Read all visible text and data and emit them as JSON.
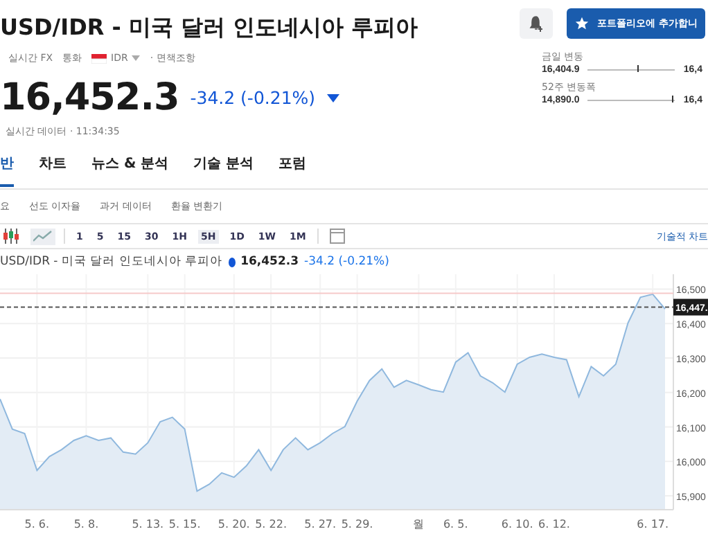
{
  "header": {
    "title": "USD/IDR - 미국 달러 인도네시아 루피아",
    "meta": [
      {
        "kind": "text",
        "text": "실시간 FX"
      },
      {
        "kind": "text",
        "text": "통화"
      },
      {
        "kind": "flag",
        "text": "IDR"
      },
      {
        "kind": "link",
        "text": "· 면책조항"
      }
    ],
    "price": "16,452.3",
    "change": "-34.2 (-0.21%)",
    "status": "실시간 데이터 · 11:34:35",
    "portfolio_button": {
      "label": "포트폴리오에 추가합니"
    }
  },
  "ranges": [
    {
      "label": "금일 변동",
      "low": "16,404.9",
      "high": "16,4",
      "level": 0.57
    },
    {
      "label": "52주 변동폭",
      "low": "14,890.0",
      "high": "16,4",
      "level": 0.97
    }
  ],
  "tabs": [
    {
      "label": "반",
      "selected": true
    },
    {
      "label": "차트",
      "selected": false
    },
    {
      "label": "뉴스 & 분석",
      "selected": false
    },
    {
      "label": "기술 분석",
      "selected": false
    },
    {
      "label": "포럼",
      "selected": false
    }
  ],
  "subtabs": [
    {
      "label": "요",
      "selected": false
    },
    {
      "label": "선도 이자율",
      "selected": false
    },
    {
      "label": "과거 데이터",
      "selected": false
    },
    {
      "label": "환율 변환기",
      "selected": false
    }
  ],
  "toolbar": {
    "chart_types": [
      {
        "kind": "candles",
        "selected": false
      },
      {
        "kind": "area",
        "selected": true
      }
    ],
    "intervals": [
      {
        "label": "1",
        "selected": false
      },
      {
        "label": "5",
        "selected": false
      },
      {
        "label": "15",
        "selected": false
      },
      {
        "label": "30",
        "selected": false
      },
      {
        "label": "1H",
        "selected": false
      },
      {
        "label": "5H",
        "selected": true
      },
      {
        "label": "1D",
        "selected": false
      },
      {
        "label": "1W",
        "selected": false
      },
      {
        "label": "1M",
        "selected": false
      }
    ],
    "right_link": "기술적 차트"
  },
  "chart": {
    "title": "USD/IDR - 미국 달러 인도네시아 루피아",
    "price": "16,452.3",
    "change": "-34.2 (-0.21%)",
    "chart_data": {
      "type": "area",
      "grid": true,
      "ylim": [
        15860,
        16543
      ],
      "ref_lines": [
        {
          "axis": "y",
          "value": 16488
        },
        {
          "axis": "y",
          "value": 16447.5,
          "label": "16,447."
        }
      ],
      "yticks": [
        {
          "value": 16500,
          "label": "16,500"
        },
        {
          "value": 16400,
          "label": "16,400"
        },
        {
          "value": 16300,
          "label": "16,300"
        },
        {
          "value": 16200,
          "label": "16,200"
        },
        {
          "value": 16100,
          "label": "16,100"
        },
        {
          "value": 16000,
          "label": "16,000"
        },
        {
          "value": 15900,
          "label": "15,900"
        }
      ],
      "categories": [
        null,
        null,
        null,
        "5. 6.",
        null,
        null,
        null,
        "5. 8.",
        null,
        null,
        null,
        null,
        "5. 13.",
        null,
        null,
        "5. 15.",
        null,
        null,
        null,
        "5. 20.",
        null,
        null,
        "5. 22.",
        null,
        null,
        null,
        "5. 27.",
        null,
        null,
        "5. 29.",
        null,
        null,
        null,
        null,
        "월",
        null,
        null,
        "6. 5.",
        null,
        null,
        null,
        null,
        "6. 10.",
        null,
        null,
        "6. 12.",
        null,
        null,
        null,
        null,
        null,
        null,
        null,
        "6. 17.",
        null
      ],
      "series": [
        {
          "color": "#8fb8de",
          "values": [
            16181,
            16094,
            16081,
            15974,
            16014,
            16034,
            16061,
            16074,
            16061,
            16068,
            16027,
            16021,
            16054,
            16115,
            16128,
            16094,
            15914,
            15934,
            15967,
            15954,
            15987,
            16034,
            15974,
            16034,
            16068,
            16034,
            16054,
            16081,
            16101,
            16175,
            16235,
            16268,
            16215,
            16235,
            16222,
            16208,
            16201,
            16288,
            16315,
            16248,
            16228,
            16201,
            16282,
            16302,
            16311,
            16302,
            16295,
            16188,
            16275,
            16248,
            16282,
            16402,
            16476,
            16485,
            16442
          ]
        }
      ]
    }
  }
}
